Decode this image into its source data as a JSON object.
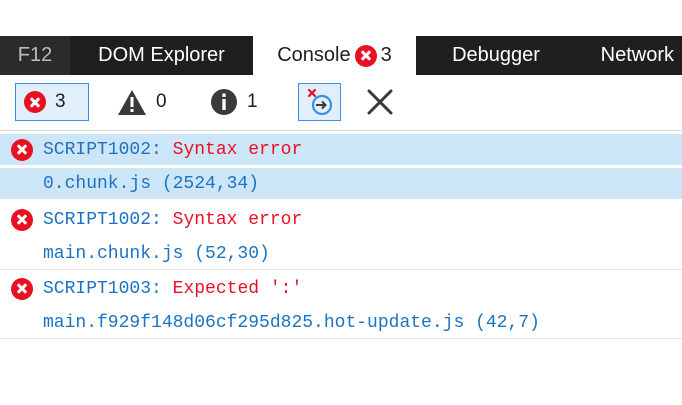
{
  "tabs": [
    {
      "label": "F12"
    },
    {
      "label": "DOM Explorer"
    },
    {
      "label": "Console",
      "error_count": "3"
    },
    {
      "label": "Debugger"
    },
    {
      "label": "Network"
    }
  ],
  "toolbar": {
    "errors_count": "3",
    "warnings_count": "0",
    "info_count": "1"
  },
  "messages": [
    {
      "code": "SCRIPT1002:",
      "text": "Syntax error",
      "source": "0.chunk.js (2524,34)",
      "highlighted": true
    },
    {
      "code": "SCRIPT1002:",
      "text": "Syntax error",
      "source": "main.chunk.js (52,30)",
      "highlighted": false
    },
    {
      "code": "SCRIPT1003:",
      "text": "Expected ':'",
      "source": "main.f929f148d06cf295d825.hot-update.js (42,7)",
      "highlighted": false
    }
  ],
  "colors": {
    "error_red": "#e81123",
    "link_blue": "#1b73c2",
    "highlight": "#cde6f7",
    "tabbar_bg": "#1f1f1f"
  }
}
